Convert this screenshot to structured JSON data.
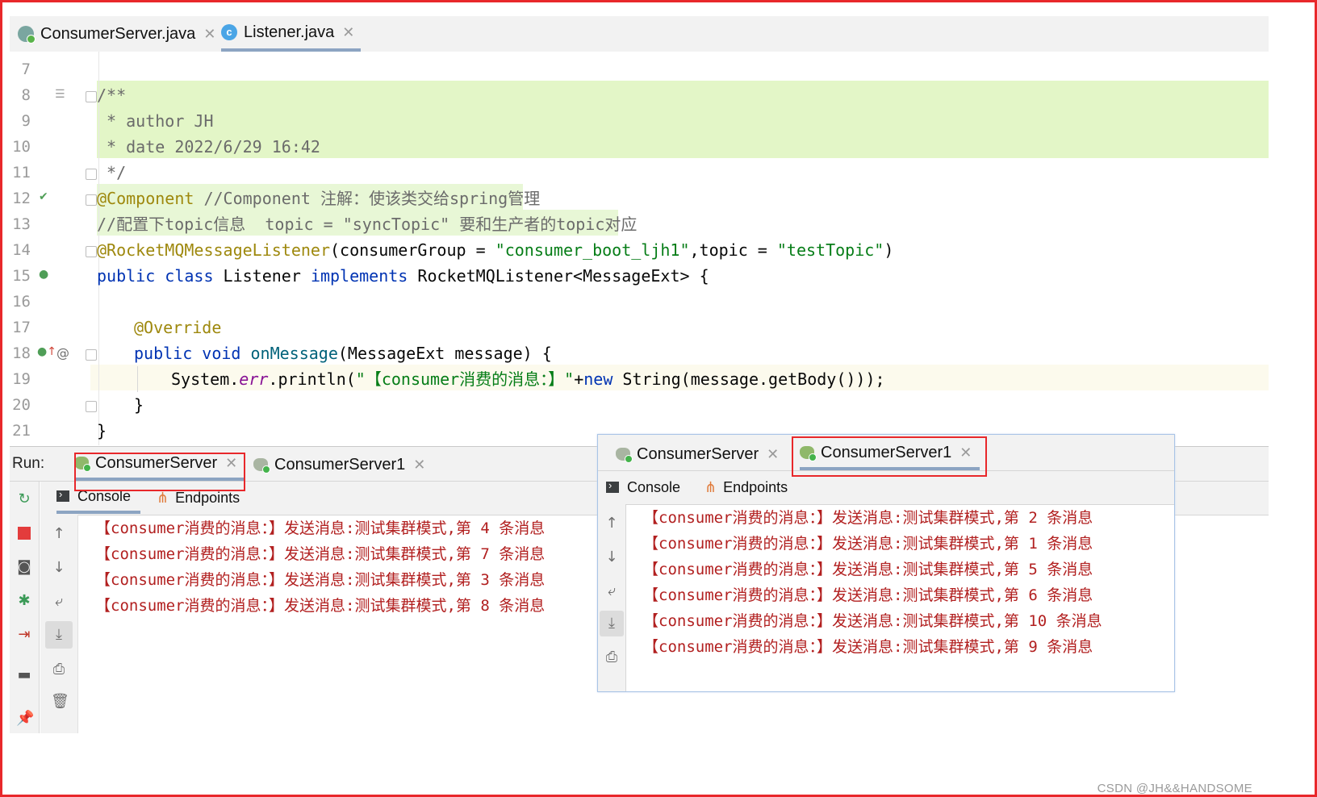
{
  "editor_tabs": [
    {
      "label": "ConsumerServer.java",
      "icon": "spring-class-icon",
      "active": false
    },
    {
      "label": "Listener.java",
      "icon": "class-icon",
      "active": true
    }
  ],
  "code_lines": [
    {
      "num": "7"
    },
    {
      "num": "8",
      "text": "/**"
    },
    {
      "num": "9",
      "text": " * author JH"
    },
    {
      "num": "10",
      "text": " * date 2022/6/29 16:42"
    },
    {
      "num": "11",
      "text": " */"
    },
    {
      "num": "12",
      "ann": "@Component",
      "comment": " //Component 注解：使该类交给spring管理"
    },
    {
      "num": "13",
      "comment": "//配置下topic信息  topic = \"syncTopic\" 要和生产者的topic对应"
    },
    {
      "num": "14",
      "ann": "@RocketMQMessageListener",
      "p1": "(consumerGroup = ",
      "s1": "\"consumer_boot_ljh1\"",
      "p2": ",topic = ",
      "s2": "\"testTopic\"",
      "p3": ")"
    },
    {
      "num": "15",
      "kw1": "public",
      "kw2": "class",
      "name": " Listener ",
      "kw3": "implements",
      "rest": " RocketMQListener<MessageExt> {"
    },
    {
      "num": "16"
    },
    {
      "num": "17",
      "ann": "@Override"
    },
    {
      "num": "18",
      "kw1": "public",
      "kw2": "void",
      "fn": "onMessage",
      "rest": "(MessageExt message) {"
    },
    {
      "num": "19",
      "p1": "System.",
      "static": "err",
      "p2": ".println(",
      "s1": "\"【consumer消费的消息：】\"",
      "p3": "+",
      "kw": "new",
      "p4": " String(message.getBody()));"
    },
    {
      "num": "20",
      "text": "}"
    },
    {
      "num": "21",
      "text": "}"
    }
  ],
  "run_panel": {
    "label": "Run:",
    "tabs": [
      {
        "label": "ConsumerServer",
        "active": true
      },
      {
        "label": "ConsumerServer1",
        "active": false
      }
    ],
    "subtabs": {
      "console": "Console",
      "endpoints": "Endpoints"
    },
    "output": [
      "【consumer消费的消息：】发送消息:测试集群模式,第 4 条消息",
      "【consumer消费的消息：】发送消息:测试集群模式,第 7 条消息",
      "【consumer消费的消息：】发送消息:测试集群模式,第 3 条消息",
      "【consumer消费的消息：】发送消息:测试集群模式,第 8 条消息"
    ]
  },
  "popup_panel": {
    "tabs": [
      {
        "label": "ConsumerServer",
        "active": false
      },
      {
        "label": "ConsumerServer1",
        "active": true
      }
    ],
    "subtabs": {
      "console": "Console",
      "endpoints": "Endpoints"
    },
    "output": [
      "【consumer消费的消息：】发送消息:测试集群模式,第 2 条消息",
      "【consumer消费的消息：】发送消息:测试集群模式,第 1 条消息",
      "【consumer消费的消息：】发送消息:测试集群模式,第 5 条消息",
      "【consumer消费的消息：】发送消息:测试集群模式,第 6 条消息",
      "【consumer消费的消息：】发送消息:测试集群模式,第 10 条消息",
      "【consumer消费的消息：】发送消息:测试集群模式,第 9 条消息"
    ]
  },
  "watermark": "CSDN @JH&&HANDSOME",
  "colors": {
    "highlight_box": "#e8282b",
    "output_text": "#b22020",
    "doc_highlight": "#e3f6c7"
  }
}
